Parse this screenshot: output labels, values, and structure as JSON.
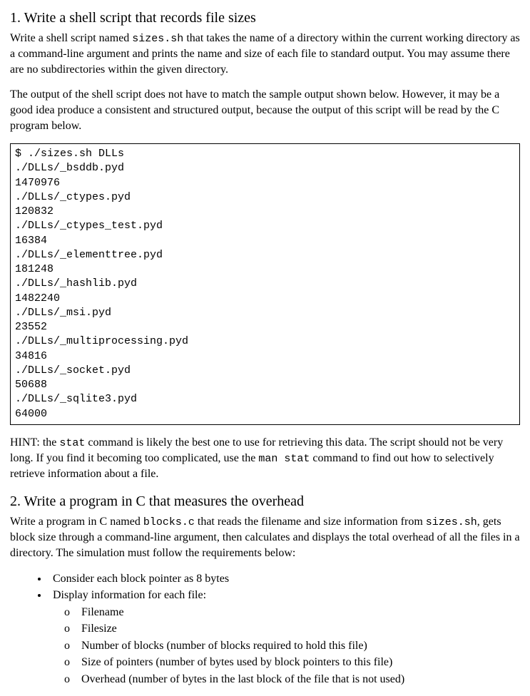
{
  "section1": {
    "heading": "1. Write a shell script that records file sizes",
    "p1_a": "Write a shell script named ",
    "p1_code": "sizes.sh",
    "p1_b": " that takes the name of a directory within the current working directory as a command-line argument and prints the name and size of each file to standard output. You may assume there are no subdirectories within the given directory.",
    "p2": "The output of the shell script does not have to match the sample output shown below. However, it may be a good idea produce a consistent and structured output, because the output of this script will be read by the C program below.",
    "code": "$ ./sizes.sh DLLs\n./DLLs/_bsddb.pyd\n1470976\n./DLLs/_ctypes.pyd\n120832\n./DLLs/_ctypes_test.pyd\n16384\n./DLLs/_elementtree.pyd\n181248\n./DLLs/_hashlib.pyd\n1482240\n./DLLs/_msi.pyd\n23552\n./DLLs/_multiprocessing.pyd\n34816\n./DLLs/_socket.pyd\n50688\n./DLLs/_sqlite3.pyd\n64000",
    "hint_a": "HINT: the ",
    "hint_code1": "stat",
    "hint_b": " command is likely the best one to use for retrieving this data. The script should not be very long. If you find it becoming too complicated, use the ",
    "hint_code2": "man stat",
    "hint_c": " command to find out how to selectively retrieve information about a file."
  },
  "section2": {
    "heading": "2. Write a program in C that measures the overhead",
    "p1_a": "Write a program in C named ",
    "p1_code1": "blocks.c",
    "p1_b": " that reads the filename and size information from ",
    "p1_code2": "sizes.sh",
    "p1_c": ", gets block size through a command-line argument, then calculates and displays the total overhead of all the files in a directory. The simulation must follow the requirements below:",
    "bullets": {
      "b1": "Consider each block pointer as 8 bytes",
      "b2": "Display information for each file:",
      "sub": {
        "s1": "Filename",
        "s2": "Filesize",
        "s3": "Number of blocks (number of blocks required to hold this file)",
        "s4": "Size of pointers (number of bytes used by block pointers to this file)",
        "s5": "Overhead (number of bytes in the last block of the file that is not used)"
      }
    }
  }
}
